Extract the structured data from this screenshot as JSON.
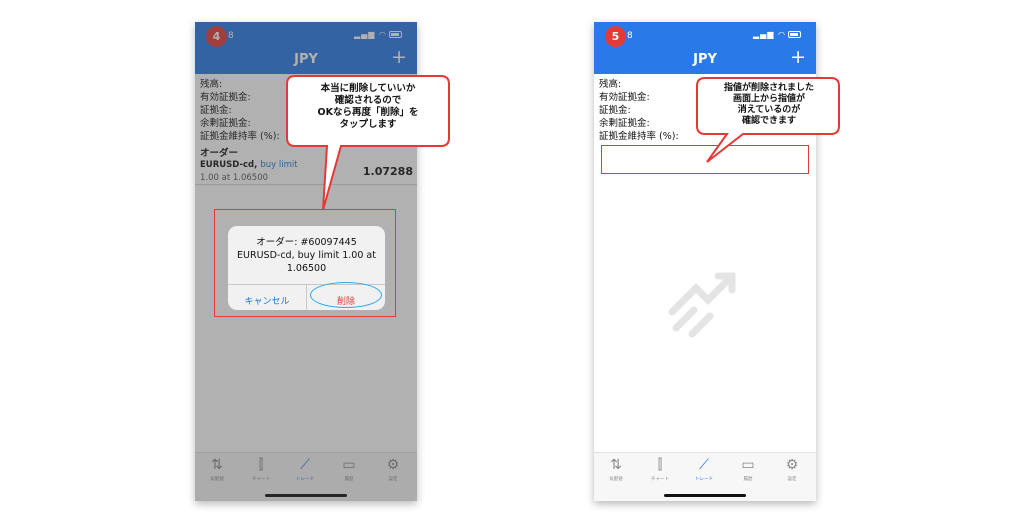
{
  "screens": [
    {
      "step": "4",
      "time": "8",
      "title": "JPY",
      "plus": "+",
      "account_labels": [
        "残高:",
        "有効証拠金:",
        "証拠金:",
        "余剰証拠金:",
        "証拠金維持率 (%):"
      ],
      "section": "オーダー",
      "order": {
        "symbol": "EURUSD-cd,",
        "type": "buy limit",
        "detail": "1.00 at 1.06500",
        "price": "1.07288"
      },
      "dialog": {
        "lines": [
          "オーダー: #60097445",
          "EURUSD-cd, buy limit 1.00 at",
          "1.06500"
        ],
        "cancel": "キャンセル",
        "delete": "削除"
      },
      "callout": [
        "本当に削除していいか",
        "確認されるので",
        "OKなら再度「削除」を",
        "タップします"
      ]
    },
    {
      "step": "5",
      "time": "8",
      "title": "JPY",
      "plus": "+",
      "account_labels": [
        "残高:",
        "有効証拠金:",
        "証拠金:",
        "余剰証拠金:",
        "証拠金維持率 (%):"
      ],
      "callout": [
        "指値が削除されました",
        "画面上から指値が",
        "消えているのが",
        "確認できます"
      ]
    }
  ],
  "tabs": [
    {
      "label": "気配値",
      "icon": "quotes-icon"
    },
    {
      "label": "チャート",
      "icon": "chart-icon"
    },
    {
      "label": "トレード",
      "icon": "trade-icon"
    },
    {
      "label": "履歴",
      "icon": "history-icon"
    },
    {
      "label": "設定",
      "icon": "settings-icon"
    }
  ],
  "colors": {
    "header": "#2979e8",
    "step_badge": "#e53935",
    "highlight": "#e53935",
    "delete": "#e53935",
    "link": "#1976d2",
    "tap_ring": "#26a9e8"
  }
}
